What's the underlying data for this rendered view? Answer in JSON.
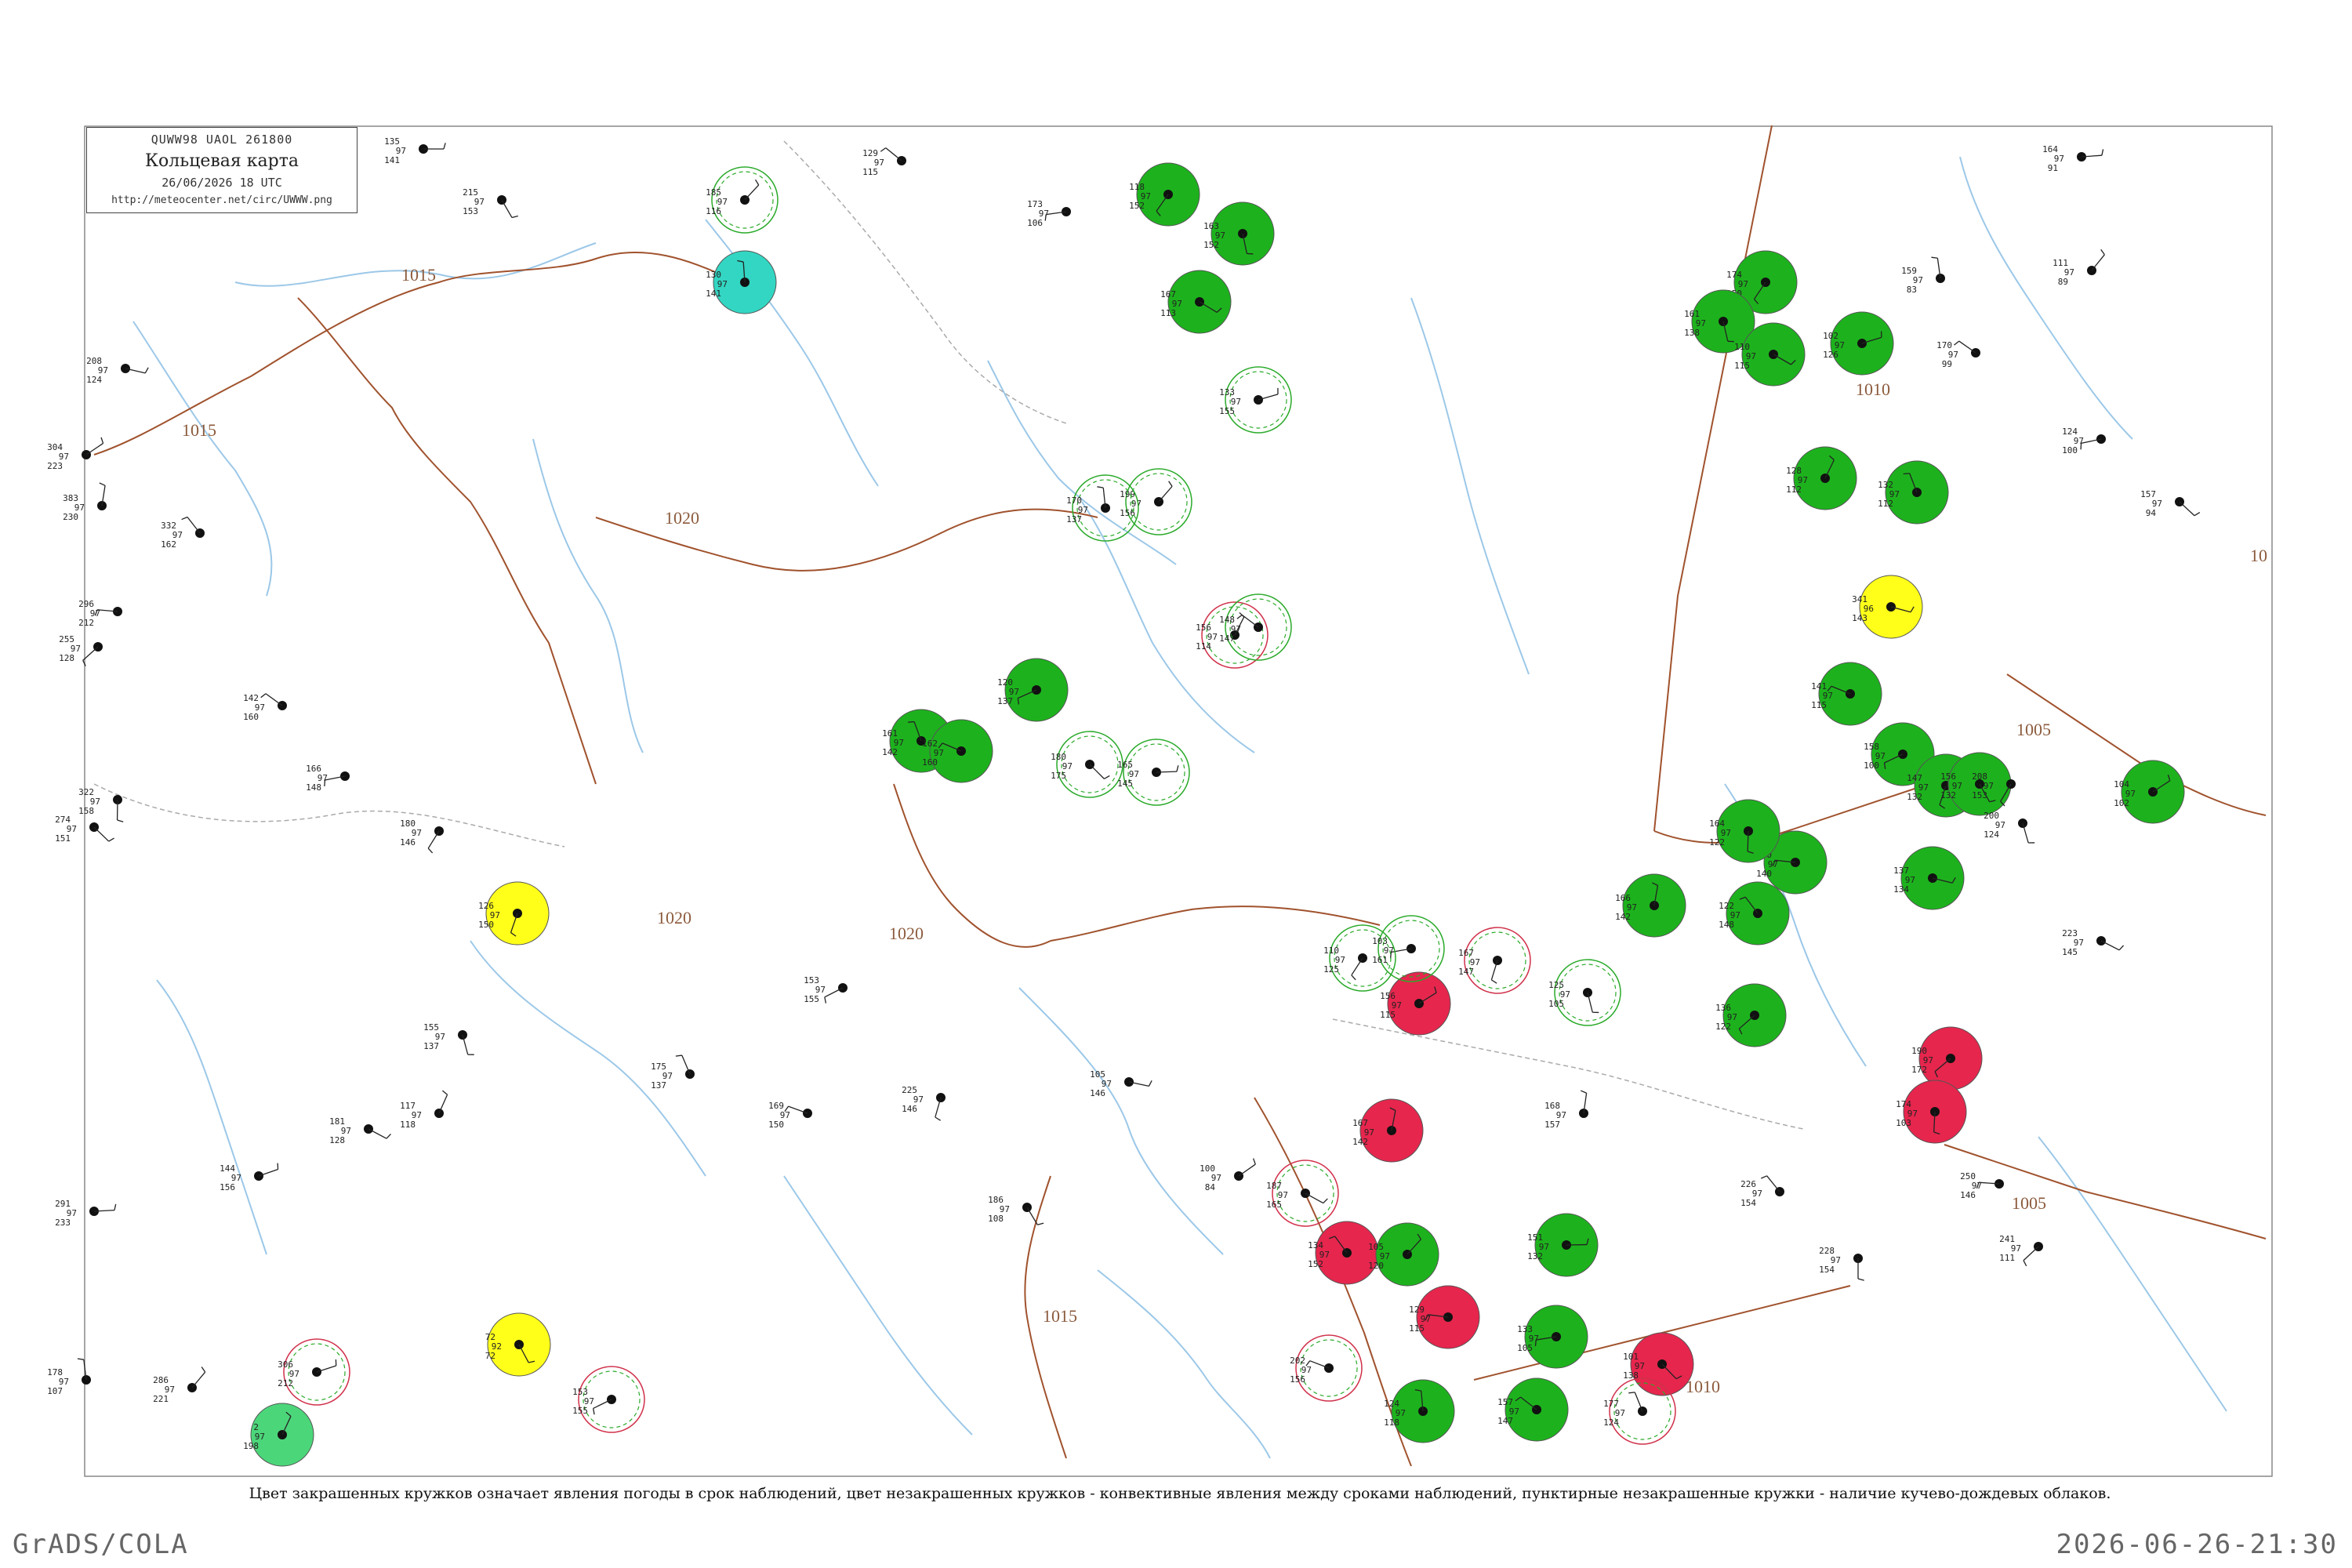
{
  "header": {
    "code": "QUWW98  UAOL  261800",
    "title": "Кольцевая карта",
    "datetime": "26/06/2026 18 UTC",
    "url": "http://meteocenter.net/circ/UWWW.png"
  },
  "isobars": [
    {
      "label": "1015"
    },
    {
      "label": "1015"
    },
    {
      "label": "1020"
    },
    {
      "label": "1020"
    },
    {
      "label": "1020"
    },
    {
      "label": "1010"
    },
    {
      "label": "1005"
    },
    {
      "label": "1005"
    },
    {
      "label": "1015"
    },
    {
      "label": "1010"
    },
    {
      "label": "10"
    }
  ],
  "colors": {
    "isobar": "#a0522d",
    "river": "#9cc8e8",
    "border": "#999999",
    "fill_green": "#1db21d",
    "fill_red": "#e6264d",
    "fill_yellow": "#ffff1a",
    "fill_cyan": "#33d6c2",
    "fill_light_green": "#4cd67a",
    "ring_green": "#2aaa2a",
    "ring_red": "#d0304a"
  },
  "stations": [
    {
      "id": "s1",
      "t": [
        "135",
        "97",
        "141"
      ],
      "style": "plain"
    },
    {
      "id": "s2",
      "t": [
        "185",
        "97",
        "116"
      ],
      "style": "ring_green"
    },
    {
      "id": "s3",
      "t": [
        "130",
        "97",
        "141"
      ],
      "style": "fill_cyan"
    },
    {
      "id": "s4",
      "t": [
        "129",
        "97",
        "115"
      ],
      "style": "plain"
    },
    {
      "id": "s5",
      "t": [
        "173",
        "97",
        "106"
      ],
      "style": "plain"
    },
    {
      "id": "s6",
      "t": [
        "118",
        "97",
        "152"
      ],
      "style": "fill_green"
    },
    {
      "id": "s7",
      "t": [
        "163",
        "97",
        "152"
      ],
      "style": "fill_green"
    },
    {
      "id": "s8",
      "t": [
        "167",
        "97",
        "113"
      ],
      "style": "fill_green"
    },
    {
      "id": "s9",
      "t": [
        "133",
        "97",
        "155"
      ],
      "style": "ring_green"
    },
    {
      "id": "s10",
      "t": [
        "156",
        "97",
        "114"
      ],
      "style": "ring_red"
    },
    {
      "id": "s11",
      "t": [
        "161",
        "97",
        "142"
      ],
      "style": "fill_green"
    },
    {
      "id": "s12",
      "t": [
        "162",
        "97",
        "160"
      ],
      "style": "fill_green"
    },
    {
      "id": "s13",
      "t": [
        "120",
        "97",
        "137"
      ],
      "style": "fill_green"
    },
    {
      "id": "s14",
      "t": [
        "126",
        "97",
        "150"
      ],
      "style": "fill_yellow"
    },
    {
      "id": "s15",
      "t": [
        "72",
        "92",
        "72"
      ],
      "style": "fill_yellow"
    },
    {
      "id": "s16",
      "t": [
        "341",
        "96",
        "143"
      ],
      "style": "fill_yellow"
    },
    {
      "id": "s17",
      "t": [
        "156",
        "97",
        "115"
      ],
      "style": "fill_red"
    },
    {
      "id": "s18",
      "t": [
        "167",
        "97",
        "142"
      ],
      "style": "fill_red"
    },
    {
      "id": "s19",
      "t": [
        "134",
        "97",
        "152"
      ],
      "style": "fill_red"
    },
    {
      "id": "s20",
      "t": [
        "129",
        "97",
        "115"
      ],
      "style": "fill_red"
    },
    {
      "id": "s21",
      "t": [
        "190",
        "97",
        "172"
      ],
      "style": "fill_red"
    },
    {
      "id": "s22",
      "t": [
        "174",
        "97",
        "103"
      ],
      "style": "fill_red"
    },
    {
      "id": "s23",
      "t": [
        "101",
        "97",
        "138"
      ],
      "style": "fill_red"
    },
    {
      "id": "s24",
      "t": [
        "151",
        "97",
        "132"
      ],
      "style": "fill_green"
    },
    {
      "id": "s25",
      "t": [
        "105",
        "97",
        "120"
      ],
      "style": "fill_green"
    },
    {
      "id": "s26",
      "t": [
        "124",
        "97",
        "118"
      ],
      "style": "fill_green"
    },
    {
      "id": "s27",
      "t": [
        "157",
        "97",
        "147"
      ],
      "style": "fill_green"
    },
    {
      "id": "s28",
      "t": [
        "133",
        "97",
        "105"
      ],
      "style": "fill_green"
    },
    {
      "id": "s29",
      "t": [
        "174",
        "97",
        "150"
      ],
      "style": "fill_green"
    },
    {
      "id": "s30",
      "t": [
        "161",
        "97",
        "138"
      ],
      "style": "fill_green"
    },
    {
      "id": "s31",
      "t": [
        "110",
        "97",
        "115"
      ],
      "style": "fill_green"
    },
    {
      "id": "s32",
      "t": [
        "102",
        "97",
        "126"
      ],
      "style": "fill_green"
    },
    {
      "id": "s33",
      "t": [
        "128",
        "97",
        "112"
      ],
      "style": "fill_green"
    },
    {
      "id": "s34",
      "t": [
        "132",
        "97",
        "112"
      ],
      "style": "fill_green"
    },
    {
      "id": "s35",
      "t": [
        "141",
        "97",
        "115"
      ],
      "style": "fill_green"
    },
    {
      "id": "s36",
      "t": [
        "158",
        "97",
        "100"
      ],
      "style": "fill_green"
    },
    {
      "id": "s37",
      "t": [
        "147",
        "97",
        "132"
      ],
      "style": "fill_green"
    },
    {
      "id": "s38",
      "t": [
        "156",
        "97",
        "132"
      ],
      "style": "fill_green"
    },
    {
      "id": "s39",
      "t": [
        "137",
        "97",
        "134"
      ],
      "style": "fill_green"
    },
    {
      "id": "s40",
      "t": [
        "104",
        "97",
        "102"
      ],
      "style": "fill_green"
    },
    {
      "id": "s41",
      "t": [
        "166",
        "97",
        "142"
      ],
      "style": "fill_green"
    },
    {
      "id": "s42",
      "t": [
        "122",
        "97",
        "148"
      ],
      "style": "fill_green"
    },
    {
      "id": "s43",
      "t": [
        "150",
        "97",
        "140"
      ],
      "style": "fill_green"
    },
    {
      "id": "s44",
      "t": [
        "136",
        "97",
        "122"
      ],
      "style": "fill_green"
    },
    {
      "id": "s45",
      "t": [
        "164",
        "97",
        "122"
      ],
      "style": "fill_green"
    },
    {
      "id": "s46",
      "t": [
        "180",
        "97",
        "175"
      ],
      "style": "ring_green"
    },
    {
      "id": "s47",
      "t": [
        "165",
        "97",
        "145"
      ],
      "style": "ring_green"
    },
    {
      "id": "s48",
      "t": [
        "199",
        "97",
        "156"
      ],
      "style": "ring_green"
    },
    {
      "id": "s49",
      "t": [
        "170",
        "97",
        "137"
      ],
      "style": "ring_green"
    },
    {
      "id": "s50",
      "t": [
        "148",
        "97",
        "147"
      ],
      "style": "ring_green"
    },
    {
      "id": "s51",
      "t": [
        "103",
        "97",
        "161"
      ],
      "style": "ring_green"
    },
    {
      "id": "s52",
      "t": [
        "110",
        "97",
        "125"
      ],
      "style": "ring_green"
    },
    {
      "id": "s53",
      "t": [
        "125",
        "97",
        "105"
      ],
      "style": "ring_green"
    },
    {
      "id": "s54",
      "t": [
        "187",
        "97",
        "165"
      ],
      "style": "ring_red"
    },
    {
      "id": "s55",
      "t": [
        "306",
        "97",
        "212"
      ],
      "style": "ring_red"
    },
    {
      "id": "s56",
      "t": [
        "2",
        "97",
        "198"
      ],
      "style": "fill_light_green"
    },
    {
      "id": "s57",
      "t": [
        "177",
        "97",
        "124"
      ],
      "style": "ring_red"
    },
    {
      "id": "s58",
      "t": [
        "202",
        "97",
        "156"
      ],
      "style": "ring_red"
    },
    {
      "id": "s59",
      "t": [
        "153",
        "97",
        "155"
      ],
      "style": "ring_red"
    },
    {
      "id": "s60",
      "t": [
        "167",
        "97",
        "147"
      ],
      "style": "ring_red"
    },
    {
      "id": "s61",
      "t": [
        "215",
        "97",
        "153"
      ],
      "style": "plain"
    },
    {
      "id": "s62",
      "t": [
        "208",
        "97",
        "124"
      ],
      "style": "plain"
    },
    {
      "id": "s63",
      "t": [
        "304",
        "97",
        "223"
      ],
      "style": "plain"
    },
    {
      "id": "s64",
      "t": [
        "383",
        "97",
        "230"
      ],
      "style": "plain"
    },
    {
      "id": "s65",
      "t": [
        "332",
        "97",
        "162"
      ],
      "style": "plain"
    },
    {
      "id": "s66",
      "t": [
        "296",
        "97",
        "212"
      ],
      "style": "plain"
    },
    {
      "id": "s67",
      "t": [
        "255",
        "97",
        "128"
      ],
      "style": "plain"
    },
    {
      "id": "s68",
      "t": [
        "322",
        "97",
        "158"
      ],
      "style": "plain"
    },
    {
      "id": "s69",
      "t": [
        "274",
        "97",
        "151"
      ],
      "style": "plain"
    },
    {
      "id": "s70",
      "t": [
        "291",
        "97",
        "233"
      ],
      "style": "plain"
    },
    {
      "id": "s71",
      "t": [
        "286",
        "97",
        "221"
      ],
      "style": "plain"
    },
    {
      "id": "s72",
      "t": [
        "178",
        "97",
        "107"
      ],
      "style": "plain"
    },
    {
      "id": "s73",
      "t": [
        "142",
        "97",
        "160"
      ],
      "style": "plain"
    },
    {
      "id": "s74",
      "t": [
        "166",
        "97",
        "148"
      ],
      "style": "plain"
    },
    {
      "id": "s75",
      "t": [
        "180",
        "97",
        "146"
      ],
      "style": "plain"
    },
    {
      "id": "s76",
      "t": [
        "155",
        "97",
        "137"
      ],
      "style": "plain"
    },
    {
      "id": "s77",
      "t": [
        "181",
        "97",
        "128"
      ],
      "style": "plain"
    },
    {
      "id": "s78",
      "t": [
        "144",
        "97",
        "156"
      ],
      "style": "plain"
    },
    {
      "id": "s79",
      "t": [
        "117",
        "97",
        "118"
      ],
      "style": "plain"
    },
    {
      "id": "s80",
      "t": [
        "175",
        "97",
        "137"
      ],
      "style": "plain"
    },
    {
      "id": "s81",
      "t": [
        "169",
        "97",
        "150"
      ],
      "style": "plain"
    },
    {
      "id": "s82",
      "t": [
        "153",
        "97",
        "155"
      ],
      "style": "plain"
    },
    {
      "id": "s83",
      "t": [
        "225",
        "97",
        "146"
      ],
      "style": "plain"
    },
    {
      "id": "s84",
      "t": [
        "186",
        "97",
        "108"
      ],
      "style": "plain"
    },
    {
      "id": "s85",
      "t": [
        "105",
        "97",
        "146"
      ],
      "style": "plain"
    },
    {
      "id": "s86",
      "t": [
        "100",
        "97",
        "84"
      ],
      "style": "plain"
    },
    {
      "id": "s87",
      "t": [
        "168",
        "97",
        "157"
      ],
      "style": "plain"
    },
    {
      "id": "s88",
      "t": [
        "226",
        "97",
        "154"
      ],
      "style": "plain"
    },
    {
      "id": "s89",
      "t": [
        "250",
        "97",
        "146"
      ],
      "style": "plain"
    },
    {
      "id": "s90",
      "t": [
        "241",
        "97",
        "111"
      ],
      "style": "plain"
    },
    {
      "id": "s91",
      "t": [
        "228",
        "97",
        "154"
      ],
      "style": "plain"
    },
    {
      "id": "s92",
      "t": [
        "157",
        "97",
        "94"
      ],
      "style": "plain"
    },
    {
      "id": "s93",
      "t": [
        "164",
        "97",
        "91"
      ],
      "style": "plain"
    },
    {
      "id": "s94",
      "t": [
        "111",
        "97",
        "89"
      ],
      "style": "plain"
    },
    {
      "id": "s95",
      "t": [
        "159",
        "97",
        "83"
      ],
      "style": "plain"
    },
    {
      "id": "s96",
      "t": [
        "170",
        "97",
        "99"
      ],
      "style": "plain"
    },
    {
      "id": "s97",
      "t": [
        "124",
        "97",
        "100"
      ],
      "style": "plain"
    },
    {
      "id": "s98",
      "t": [
        "208",
        "97",
        "153"
      ],
      "style": "plain"
    },
    {
      "id": "s99",
      "t": [
        "200",
        "97",
        "124"
      ],
      "style": "plain"
    },
    {
      "id": "s100",
      "t": [
        "223",
        "97",
        "145"
      ],
      "style": "plain"
    }
  ],
  "caption": "Цвет закрашенных кружков означает явления погоды в срок наблюдений, цвет незакрашенных кружков - конвективные явления между сроками наблюдений, пунктирные незакрашенные кружки - наличие кучево-дождевых облаков.",
  "footer": {
    "left": "GrADS/COLA",
    "right": "2026-06-26-21:30"
  }
}
